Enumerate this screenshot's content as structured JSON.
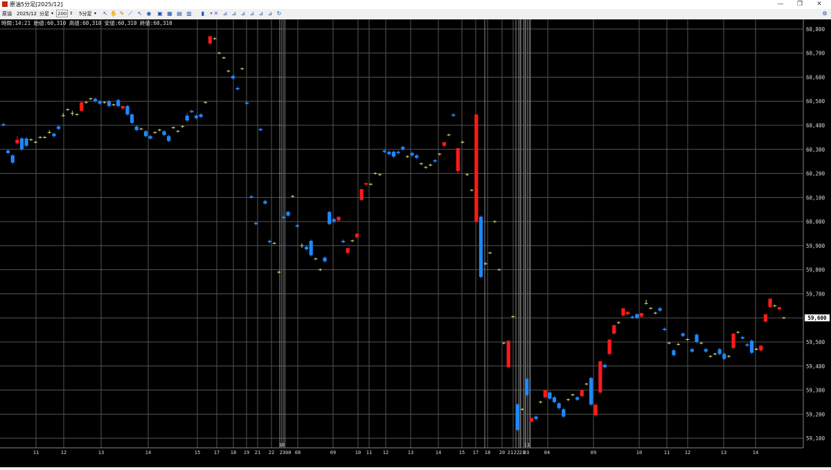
{
  "window": {
    "title": "原油5分足[2025/12]",
    "minimize": "—",
    "restore": "❐",
    "close": "✕"
  },
  "toolbar": {
    "product": "原油",
    "contract": "2025/12",
    "interval_label": "分足",
    "count": "200",
    "period": "5分足"
  },
  "info_line": "時間:14:21 始値:60,310 高値:60,310 安値:60,310 終値:60,310",
  "chart_data": {
    "type": "candlestick",
    "title": "原油5分足[2025/12]",
    "y_ticks": [
      "59,100",
      "59,200",
      "59,300",
      "59,400",
      "59,500",
      "59,600",
      "59,700",
      "59,800",
      "59,900",
      "60,000",
      "60,100",
      "60,200",
      "60,300",
      "60,400",
      "60,500",
      "60,600",
      "60,700",
      "60,800"
    ],
    "ylim": [
      59060,
      60840
    ],
    "current_price": 59600,
    "current_price_label": "59,600",
    "x_labels": [
      "11",
      "12",
      "13",
      "14",
      "15",
      "17",
      "18",
      "19",
      "21",
      "22",
      "2300",
      "08",
      "09",
      "10",
      "11",
      "12",
      "13",
      "14",
      "15",
      "17",
      "18",
      "20",
      "21",
      "22",
      "23",
      "03",
      "04",
      "09",
      "10",
      "11",
      "12",
      "13",
      "14",
      "15"
    ],
    "date_labels": [
      "10",
      "11"
    ],
    "grid": true,
    "colors": {
      "up": "#ff1a1a",
      "down": "#1e88ff",
      "flat": "#d4d47a",
      "grid": "#555555",
      "separator": "#8a8a8a"
    },
    "candles": [
      {
        "o": 60405,
        "h": 60410,
        "c": 60400,
        "l": 60395
      },
      {
        "o": 60295,
        "h": 60300,
        "c": 60285,
        "l": 60280
      },
      {
        "o": 60275,
        "h": 60280,
        "c": 60245,
        "l": 60240
      },
      {
        "o": 60325,
        "h": 60355,
        "c": 60340,
        "l": 60320
      },
      {
        "o": 60345,
        "h": 60350,
        "c": 60300,
        "l": 60295
      },
      {
        "o": 60345,
        "h": 60350,
        "c": 60315,
        "l": 60310
      },
      {
        "o": 60340,
        "h": 60345,
        "c": 60340,
        "l": 60335
      },
      {
        "o": 60330,
        "h": 60335,
        "c": 60330,
        "l": 60325
      },
      {
        "o": 60350,
        "h": 60355,
        "c": 60350,
        "l": 60345
      },
      {
        "o": 60350,
        "h": 60355,
        "c": 60350,
        "l": 60345
      },
      {
        "o": 60370,
        "h": 60380,
        "c": 60370,
        "l": 60365
      },
      {
        "o": 60365,
        "h": 60370,
        "c": 60355,
        "l": 60350
      },
      {
        "o": 60395,
        "h": 60400,
        "c": 60385,
        "l": 60380
      },
      {
        "o": 60440,
        "h": 60450,
        "c": 60440,
        "l": 60435
      },
      {
        "o": 60465,
        "h": 60470,
        "c": 60465,
        "l": 60460
      },
      {
        "o": 60450,
        "h": 60460,
        "c": 60450,
        "l": 60440
      },
      {
        "o": 60445,
        "h": 60450,
        "c": 60445,
        "l": 60440
      },
      {
        "o": 60460,
        "h": 60500,
        "c": 60495,
        "l": 60455
      },
      {
        "o": 60495,
        "h": 60500,
        "c": 60495,
        "l": 60490
      },
      {
        "o": 60510,
        "h": 60515,
        "c": 60510,
        "l": 60505
      },
      {
        "o": 60510,
        "h": 60515,
        "c": 60500,
        "l": 60495
      },
      {
        "o": 60500,
        "h": 60505,
        "c": 60490,
        "l": 60485
      },
      {
        "o": 60495,
        "h": 60500,
        "c": 60495,
        "l": 60490
      },
      {
        "o": 60500,
        "h": 60505,
        "c": 60480,
        "l": 60475
      },
      {
        "o": 60485,
        "h": 60490,
        "c": 60485,
        "l": 60480
      },
      {
        "o": 60505,
        "h": 60510,
        "c": 60480,
        "l": 60475
      },
      {
        "o": 60470,
        "h": 60480,
        "c": 60480,
        "l": 60465
      },
      {
        "o": 60480,
        "h": 60485,
        "c": 60445,
        "l": 60440
      },
      {
        "o": 60445,
        "h": 60450,
        "c": 60410,
        "l": 60405
      },
      {
        "o": 60395,
        "h": 60400,
        "c": 60380,
        "l": 60375
      },
      {
        "o": 60385,
        "h": 60390,
        "c": 60385,
        "l": 60380
      },
      {
        "o": 60375,
        "h": 60380,
        "c": 60355,
        "l": 60350
      },
      {
        "o": 60355,
        "h": 60360,
        "c": 60345,
        "l": 60340
      },
      {
        "o": 60370,
        "h": 60375,
        "c": 60370,
        "l": 60365
      },
      {
        "o": 60380,
        "h": 60385,
        "c": 60380,
        "l": 60375
      },
      {
        "o": 60375,
        "h": 60380,
        "c": 60360,
        "l": 60355
      },
      {
        "o": 60355,
        "h": 60360,
        "c": 60335,
        "l": 60330
      },
      {
        "o": 60390,
        "h": 60395,
        "c": 60390,
        "l": 60385
      },
      {
        "o": 60375,
        "h": 60380,
        "c": 60375,
        "l": 60370
      },
      {
        "o": 60395,
        "h": 60400,
        "c": 60395,
        "l": 60390
      },
      {
        "o": 60440,
        "h": 60450,
        "c": 60420,
        "l": 60415
      },
      {
        "o": 60460,
        "h": 60465,
        "c": 60455,
        "l": 60450
      },
      {
        "o": 60440,
        "h": 60445,
        "c": 60430,
        "l": 60425
      },
      {
        "o": 60445,
        "h": 60450,
        "c": 60435,
        "l": 60430
      },
      {
        "o": 60495,
        "h": 60500,
        "c": 60495,
        "l": 60490
      },
      {
        "o": 60740,
        "h": 60750,
        "c": 60770,
        "l": 60735
      },
      {
        "o": 60760,
        "h": 60765,
        "c": 60760,
        "l": 60755
      },
      {
        "o": 60700,
        "h": 60705,
        "c": 60700,
        "l": 60695
      },
      {
        "o": 60680,
        "h": 60685,
        "c": 60680,
        "l": 60675
      },
      {
        "o": 60625,
        "h": 60630,
        "c": 60625,
        "l": 60620
      },
      {
        "o": 60605,
        "h": 60610,
        "c": 60595,
        "l": 60590
      },
      {
        "o": 60555,
        "h": 60560,
        "c": 60550,
        "l": 60545
      },
      {
        "o": 60635,
        "h": 60640,
        "c": 60635,
        "l": 60630
      },
      {
        "o": 60495,
        "h": 60500,
        "c": 60490,
        "l": 60485
      },
      {
        "o": 60105,
        "h": 60110,
        "c": 60100,
        "l": 60095
      },
      {
        "o": 59995,
        "h": 60000,
        "c": 59990,
        "l": 59985
      },
      {
        "o": 60385,
        "h": 60390,
        "c": 60380,
        "l": 60375
      },
      {
        "o": 60085,
        "h": 60090,
        "c": 60075,
        "l": 60070
      },
      {
        "o": 59920,
        "h": 59925,
        "c": 59915,
        "l": 59910
      },
      {
        "o": 59910,
        "h": 59915,
        "c": 59910,
        "l": 59905
      },
      {
        "o": 59790,
        "h": 59795,
        "c": 59790,
        "l": 59785
      },
      {
        "o": 60020,
        "h": 60025,
        "c": 60015,
        "l": 60010
      },
      {
        "o": 60040,
        "h": 60045,
        "c": 60025,
        "l": 60020
      },
      {
        "o": 60105,
        "h": 60110,
        "c": 60105,
        "l": 60100
      },
      {
        "o": 59985,
        "h": 59990,
        "c": 59980,
        "l": 59975
      },
      {
        "o": 59900,
        "h": 59910,
        "c": 59900,
        "l": 59890
      },
      {
        "o": 59895,
        "h": 59900,
        "c": 59885,
        "l": 59880
      },
      {
        "o": 59920,
        "h": 59925,
        "c": 59860,
        "l": 59855
      },
      {
        "o": 59845,
        "h": 59850,
        "c": 59845,
        "l": 59840
      },
      {
        "o": 59800,
        "h": 59805,
        "c": 59800,
        "l": 59795
      },
      {
        "o": 59850,
        "h": 59855,
        "c": 59835,
        "l": 59830
      },
      {
        "o": 60040,
        "h": 60045,
        "c": 59990,
        "l": 59985
      },
      {
        "o": 60010,
        "h": 60015,
        "c": 60000,
        "l": 59995
      },
      {
        "o": 60005,
        "h": 60010,
        "c": 60020,
        "l": 60000
      },
      {
        "o": 59920,
        "h": 59925,
        "c": 59915,
        "l": 59910
      },
      {
        "o": 59870,
        "h": 59875,
        "c": 59890,
        "l": 59865
      },
      {
        "o": 59920,
        "h": 59925,
        "c": 59920,
        "l": 59915
      },
      {
        "o": 59935,
        "h": 59940,
        "c": 59950,
        "l": 59930
      },
      {
        "o": 60090,
        "h": 60095,
        "c": 60135,
        "l": 60085
      },
      {
        "o": 60155,
        "h": 60160,
        "c": 60160,
        "l": 60150
      },
      {
        "o": 60155,
        "h": 60160,
        "c": 60155,
        "l": 60150
      },
      {
        "o": 60200,
        "h": 60205,
        "c": 60200,
        "l": 60195
      },
      {
        "o": 60195,
        "h": 60200,
        "c": 60195,
        "l": 60190
      },
      {
        "o": 60295,
        "h": 60300,
        "c": 60290,
        "l": 60285
      },
      {
        "o": 60290,
        "h": 60295,
        "c": 60280,
        "l": 60275
      },
      {
        "o": 60290,
        "h": 60295,
        "c": 60270,
        "l": 60265
      },
      {
        "o": 60290,
        "h": 60295,
        "c": 60285,
        "l": 60280
      },
      {
        "o": 60310,
        "h": 60315,
        "c": 60300,
        "l": 60295
      },
      {
        "o": 60270,
        "h": 60275,
        "c": 60270,
        "l": 60265
      },
      {
        "o": 60285,
        "h": 60290,
        "c": 60275,
        "l": 60270
      },
      {
        "o": 60275,
        "h": 60280,
        "c": 60265,
        "l": 60260
      },
      {
        "o": 60240,
        "h": 60245,
        "c": 60240,
        "l": 60235
      },
      {
        "o": 60225,
        "h": 60230,
        "c": 60225,
        "l": 60220
      },
      {
        "o": 60235,
        "h": 60240,
        "c": 60235,
        "l": 60230
      },
      {
        "o": 60255,
        "h": 60260,
        "c": 60250,
        "l": 60245
      },
      {
        "o": 60280,
        "h": 60285,
        "c": 60280,
        "l": 60275
      },
      {
        "o": 60315,
        "h": 60320,
        "c": 60330,
        "l": 60310
      },
      {
        "o": 60360,
        "h": 60365,
        "c": 60360,
        "l": 60355
      },
      {
        "o": 60445,
        "h": 60450,
        "c": 60440,
        "l": 60435
      },
      {
        "o": 60210,
        "h": 60215,
        "c": 60305,
        "l": 60200
      },
      {
        "o": 60330,
        "h": 60335,
        "c": 60330,
        "l": 60325
      },
      {
        "o": 60195,
        "h": 60200,
        "c": 60195,
        "l": 60190
      },
      {
        "o": 60130,
        "h": 60135,
        "c": 60130,
        "l": 60125
      },
      {
        "o": 60000,
        "h": 60005,
        "c": 60445,
        "l": 59995
      },
      {
        "o": 60020,
        "h": 60025,
        "c": 59770,
        "l": 59765
      },
      {
        "o": 59825,
        "h": 59830,
        "c": 59825,
        "l": 59820
      },
      {
        "o": 59870,
        "h": 59875,
        "c": 59870,
        "l": 59865
      },
      {
        "o": 60000,
        "h": 60005,
        "c": 60000,
        "l": 59995
      },
      {
        "o": 59800,
        "h": 59805,
        "c": 59800,
        "l": 59795
      },
      {
        "o": 59495,
        "h": 59500,
        "c": 59495,
        "l": 59490
      },
      {
        "o": 59395,
        "h": 59400,
        "c": 59505,
        "l": 59390
      },
      {
        "o": 59605,
        "h": 59610,
        "c": 59605,
        "l": 59600
      },
      {
        "o": 59240,
        "h": 59245,
        "c": 59135,
        "l": 59130
      },
      {
        "o": 59220,
        "h": 59225,
        "c": 59220,
        "l": 59215
      },
      {
        "o": 59345,
        "h": 59350,
        "c": 59280,
        "l": 59275
      },
      {
        "o": 59170,
        "h": 59175,
        "c": 59185,
        "l": 59165
      },
      {
        "o": 59190,
        "h": 59195,
        "c": 59180,
        "l": 59175
      },
      {
        "o": 59250,
        "h": 59255,
        "c": 59250,
        "l": 59245
      },
      {
        "o": 59270,
        "h": 59275,
        "c": 59300,
        "l": 59265
      },
      {
        "o": 59290,
        "h": 59295,
        "c": 59265,
        "l": 59260
      },
      {
        "o": 59270,
        "h": 59275,
        "c": 59250,
        "l": 59245
      },
      {
        "o": 59245,
        "h": 59250,
        "c": 59225,
        "l": 59220
      },
      {
        "o": 59220,
        "h": 59225,
        "c": 59190,
        "l": 59185
      },
      {
        "o": 59260,
        "h": 59265,
        "c": 59260,
        "l": 59255
      },
      {
        "o": 59280,
        "h": 59285,
        "c": 59280,
        "l": 59275
      },
      {
        "o": 59270,
        "h": 59275,
        "c": 59260,
        "l": 59255
      },
      {
        "o": 59275,
        "h": 59280,
        "c": 59300,
        "l": 59270
      },
      {
        "o": 59325,
        "h": 59330,
        "c": 59325,
        "l": 59320
      },
      {
        "o": 59350,
        "h": 59355,
        "c": 59240,
        "l": 59235
      },
      {
        "o": 59195,
        "h": 59200,
        "c": 59240,
        "l": 59190
      },
      {
        "o": 59290,
        "h": 59295,
        "c": 59420,
        "l": 59285
      },
      {
        "o": 59405,
        "h": 59410,
        "c": 59395,
        "l": 59390
      },
      {
        "o": 59450,
        "h": 59455,
        "c": 59510,
        "l": 59445
      },
      {
        "o": 59535,
        "h": 59540,
        "c": 59570,
        "l": 59530
      },
      {
        "o": 59580,
        "h": 59585,
        "c": 59580,
        "l": 59575
      },
      {
        "o": 59610,
        "h": 59615,
        "c": 59640,
        "l": 59605
      },
      {
        "o": 59615,
        "h": 59620,
        "c": 59625,
        "l": 59610
      },
      {
        "o": 59605,
        "h": 59610,
        "c": 59600,
        "l": 59595
      },
      {
        "o": 59615,
        "h": 59620,
        "c": 59600,
        "l": 59595
      },
      {
        "o": 59605,
        "h": 59610,
        "c": 59620,
        "l": 59600
      },
      {
        "o": 59660,
        "h": 59675,
        "c": 59660,
        "l": 59655
      },
      {
        "o": 59640,
        "h": 59645,
        "c": 59640,
        "l": 59635
      },
      {
        "o": 59620,
        "h": 59625,
        "c": 59620,
        "l": 59615
      },
      {
        "o": 59640,
        "h": 59645,
        "c": 59630,
        "l": 59625
      },
      {
        "o": 59555,
        "h": 59560,
        "c": 59550,
        "l": 59545
      },
      {
        "o": 59495,
        "h": 59500,
        "c": 59495,
        "l": 59490
      },
      {
        "o": 59465,
        "h": 59470,
        "c": 59445,
        "l": 59440
      },
      {
        "o": 59490,
        "h": 59495,
        "c": 59490,
        "l": 59485
      },
      {
        "o": 59535,
        "h": 59540,
        "c": 59525,
        "l": 59520
      },
      {
        "o": 59510,
        "h": 59515,
        "c": 59510,
        "l": 59505
      },
      {
        "o": 59470,
        "h": 59475,
        "c": 59460,
        "l": 59455
      },
      {
        "o": 59530,
        "h": 59535,
        "c": 59500,
        "l": 59495
      },
      {
        "o": 59495,
        "h": 59500,
        "c": 59495,
        "l": 59490
      },
      {
        "o": 59470,
        "h": 59475,
        "c": 59460,
        "l": 59455
      },
      {
        "o": 59440,
        "h": 59445,
        "c": 59440,
        "l": 59435
      },
      {
        "o": 59450,
        "h": 59455,
        "c": 59450,
        "l": 59445
      },
      {
        "o": 59470,
        "h": 59475,
        "c": 59450,
        "l": 59445
      },
      {
        "o": 59450,
        "h": 59455,
        "c": 59430,
        "l": 59425
      },
      {
        "o": 59440,
        "h": 59445,
        "c": 59440,
        "l": 59435
      },
      {
        "o": 59475,
        "h": 59480,
        "c": 59535,
        "l": 59470
      },
      {
        "o": 59540,
        "h": 59545,
        "c": 59540,
        "l": 59535
      },
      {
        "o": 59520,
        "h": 59525,
        "c": 59515,
        "l": 59510
      },
      {
        "o": 59490,
        "h": 59495,
        "c": 59485,
        "l": 59480
      },
      {
        "o": 59505,
        "h": 59510,
        "c": 59455,
        "l": 59450
      },
      {
        "o": 59470,
        "h": 59475,
        "c": 59470,
        "l": 59465
      },
      {
        "o": 59465,
        "h": 59470,
        "c": 59485,
        "l": 59460
      },
      {
        "o": 59585,
        "h": 59590,
        "c": 59615,
        "l": 59580
      },
      {
        "o": 59645,
        "h": 59650,
        "c": 59680,
        "l": 59640
      },
      {
        "o": 59650,
        "h": 59655,
        "c": 59650,
        "l": 59645
      },
      {
        "o": 59635,
        "h": 59640,
        "c": 59645,
        "l": 59630
      },
      {
        "o": 59600,
        "h": 59605,
        "c": 59600,
        "l": 59595
      }
    ]
  }
}
